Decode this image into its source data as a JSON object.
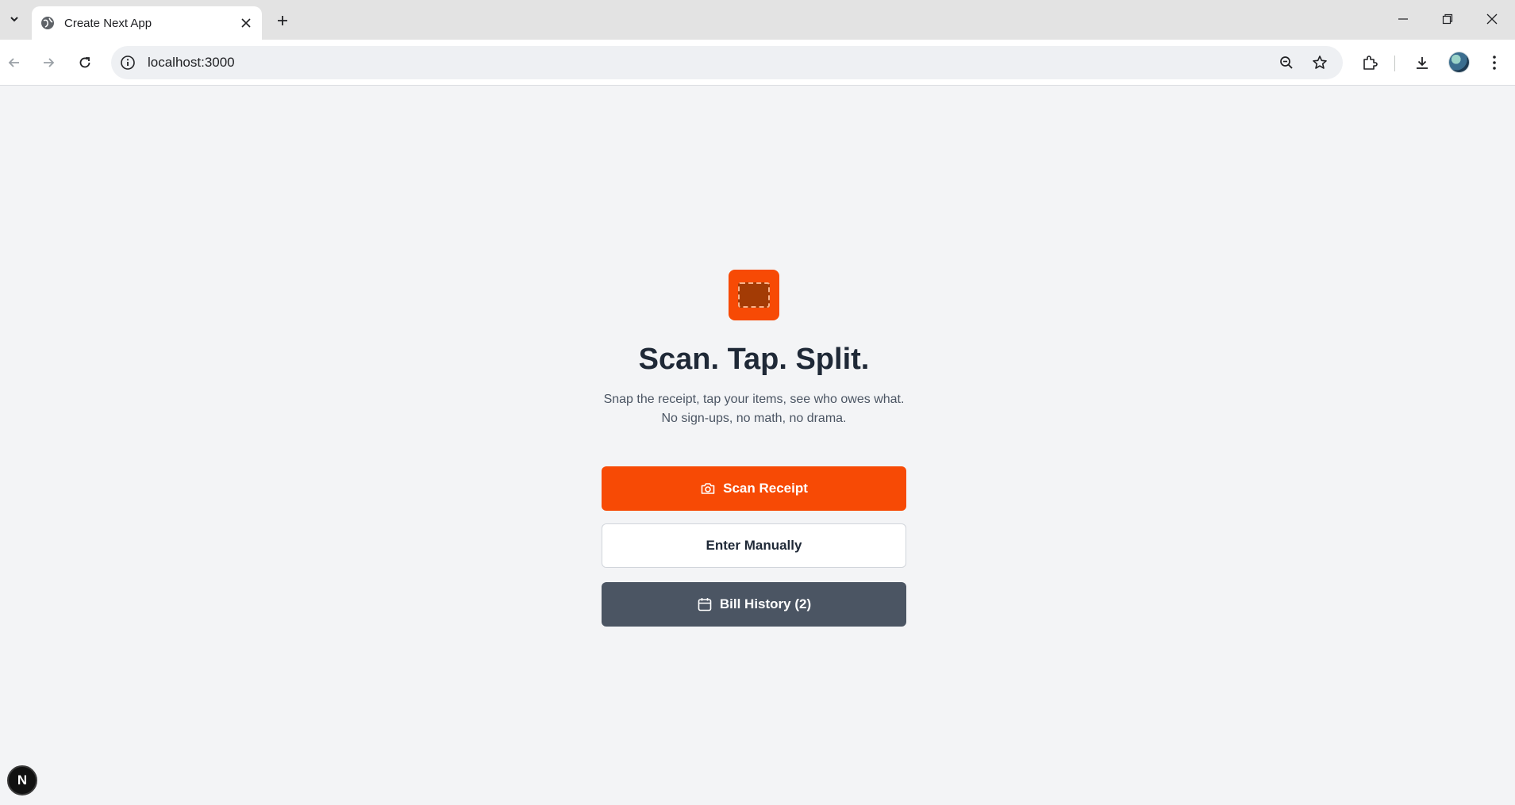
{
  "browser": {
    "tab_title": "Create Next App",
    "url": "localhost:3000",
    "icons": {
      "tab_list": "chevron-down-icon",
      "favicon": "globe-icon",
      "tab_close": "close-icon",
      "new_tab": "plus-icon",
      "back": "arrow-left-icon",
      "forward": "arrow-right-icon",
      "reload": "reload-icon",
      "site_info": "info-icon",
      "zoom": "zoom-out-icon",
      "bookmark": "star-icon",
      "extensions": "puzzle-icon",
      "downloads": "download-icon",
      "menu": "kebab-menu-icon",
      "minimize": "minimize-icon",
      "restore": "restore-icon",
      "close_window": "close-icon"
    }
  },
  "hero": {
    "title": "Scan. Tap. Split.",
    "subtitle_line1": "Snap the receipt, tap your items, see who owes what.",
    "subtitle_line2": "No sign-ups, no math, no drama."
  },
  "actions": {
    "scan_label": "Scan Receipt",
    "manual_label": "Enter Manually",
    "history_label": "Bill History (2)"
  },
  "dev_badge": {
    "label": "N"
  },
  "colors": {
    "accent": "#f74a05",
    "dark_button": "#4b5563",
    "title": "#1f2937",
    "page_bg": "#f3f4f6"
  }
}
